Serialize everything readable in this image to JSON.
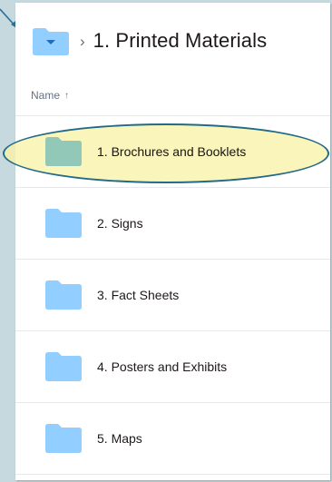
{
  "breadcrumb": {
    "current": "1. Printed Materials",
    "separator": "›"
  },
  "list": {
    "column_name_label": "Name",
    "sort_indicator": "↑",
    "items": [
      {
        "label": "1. Brochures and Booklets",
        "highlighted": true
      },
      {
        "label": "2. Signs"
      },
      {
        "label": "3. Fact Sheets"
      },
      {
        "label": "4. Posters and Exhibits"
      },
      {
        "label": "5. Maps"
      }
    ]
  },
  "colors": {
    "background": "#c6d9df",
    "folder": "#92ceff",
    "folder_highlighted": "#92c8b8",
    "highlight_fill": "#f8f4a8",
    "highlight_border": "#236a87",
    "arrow": "#2a6f9b"
  },
  "icons": {
    "folder": "folder-icon",
    "breadcrumb_separator": "chevron-right-icon",
    "sort": "arrow-up-icon"
  }
}
